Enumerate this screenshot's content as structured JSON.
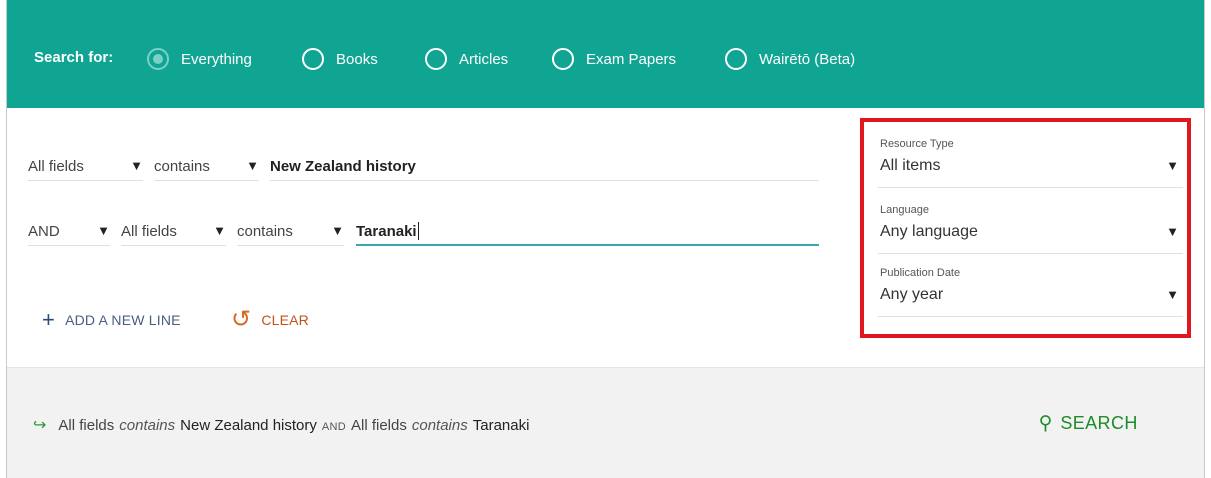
{
  "search_for": {
    "label": "Search for:",
    "options": [
      {
        "label": "Everything",
        "checked": true
      },
      {
        "label": "Books",
        "checked": false
      },
      {
        "label": "Articles",
        "checked": false
      },
      {
        "label": "Exam Papers",
        "checked": false
      },
      {
        "label": "Wairētō (Beta)",
        "checked": false
      }
    ]
  },
  "query": {
    "line1": {
      "field": "All fields",
      "operator": "contains",
      "value": "New Zealand history"
    },
    "line2": {
      "boolean": "AND",
      "field": "All fields",
      "operator": "contains",
      "value": "Taranaki"
    }
  },
  "actions": {
    "add_line": "ADD A NEW LINE",
    "clear": "CLEAR",
    "add_icon": "plus-icon",
    "clear_icon": "undo-icon"
  },
  "filters": {
    "resource_type": {
      "label": "Resource Type",
      "value": "All items"
    },
    "language": {
      "label": "Language",
      "value": "Any language"
    },
    "publication_date": {
      "label": "Publication Date",
      "value": "Any year"
    }
  },
  "summary": {
    "part1_field": "All fields",
    "part1_op": "contains",
    "part1_value": "New Zealand history",
    "bool": "AND",
    "part2_field": "All fields",
    "part2_op": "contains",
    "part2_value": "Taranaki"
  },
  "search_button": "SEARCH",
  "colors": {
    "header_bg": "#10a493",
    "highlight_border": "#e0171f",
    "search_green": "#1e8c2a",
    "clear_orange": "#c0531c"
  }
}
